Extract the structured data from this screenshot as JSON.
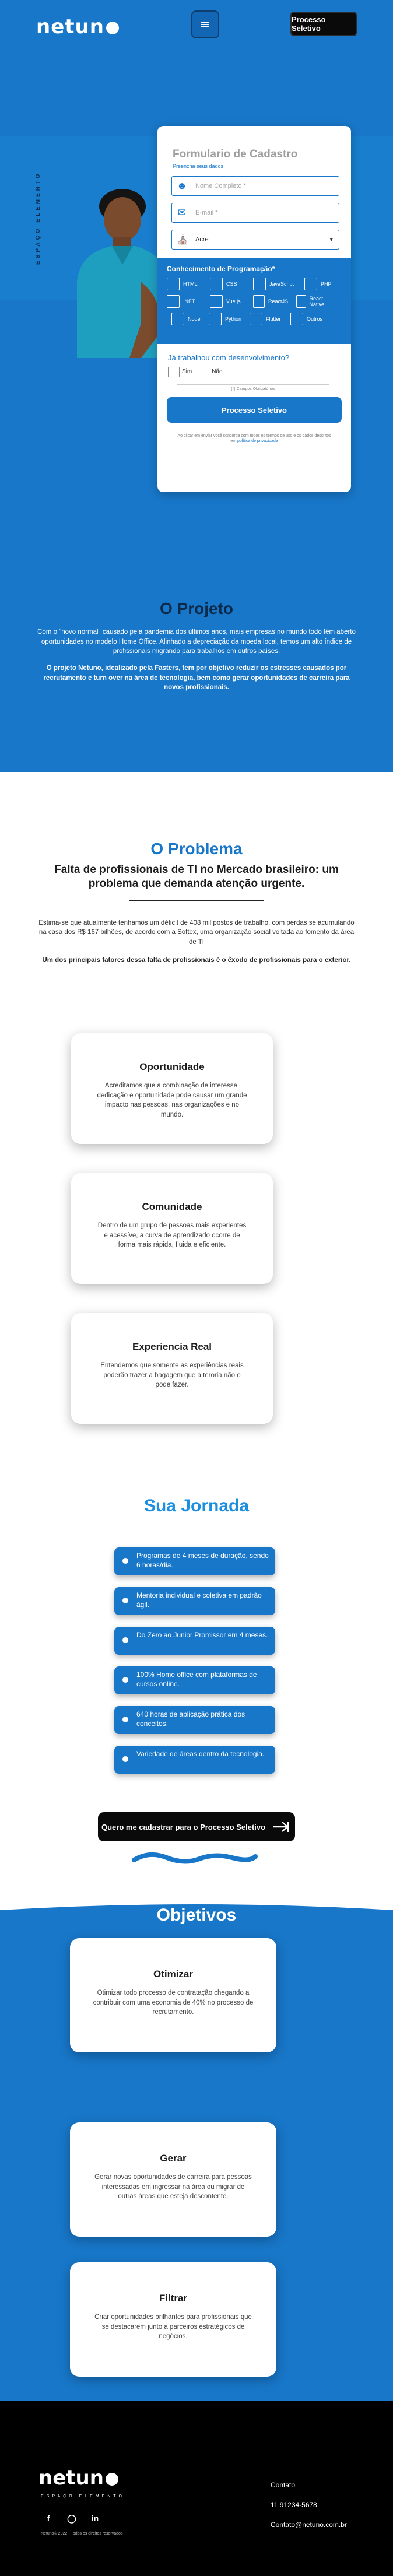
{
  "header": {
    "logo": "netun",
    "menu_label": "menu",
    "cta": "Processo Seletivo"
  },
  "hero": {
    "side_text": "ESPAÇO ELEMENTO",
    "form": {
      "title": "Formulario de Cadastro",
      "subtitle": "Preencha seus dados",
      "name_placeholder": "Nome Completo *",
      "email_placeholder": "E-mail *",
      "state_value": "Acre",
      "skills_title": "Conhecimento de Programação*",
      "skills_row1": [
        "HTML",
        "CSS",
        "JavaScript",
        "PHP"
      ],
      "skills_row2": [
        ".NET",
        "Vue.js",
        "ReactJS",
        "React Native"
      ],
      "skills_row3": [
        "Node",
        "Python",
        "Flutter",
        "Outros"
      ],
      "question": "Já trabalhou com desenvolvimento?",
      "yes": "Sim",
      "no": "Não",
      "required_note": "(*) Campos Obrigatórios",
      "submit": "Processo Seletivo",
      "fine_print": "Ao clicar em enviar você concorda com todos os termos de uso e os dados descritos em",
      "fine_link": "política de privacidade"
    }
  },
  "projeto": {
    "title": "O Projeto",
    "p1": "Com o \"novo normal\" causado pela pandemia dos últimos anos, mais empresas no mundo todo têm aberto oportunidades no modelo Home Office. Alinhado a depreciação da moeda local, temos um alto índice de profissionais migrando para trabalhos em outros países.",
    "p2": "O projeto Netuno, idealizado pela Fasters, tem por objetivo reduzir os estresses causados por recrutamento e turn over na área de tecnologia, bem como gerar oportunidades de carreira para novos profissionais."
  },
  "problema": {
    "title": "O Problema",
    "subtitle": "Falta de profissionais de TI no Mercado brasileiro: um problema que demanda atenção urgente.",
    "p1": "Estima-se que atualmente tenhamos um déficit de 408 mil postos de trabalho, com perdas se acumulando na casa dos R$ 167 bilhões, de acordo com a Softex, uma organização social voltada ao fomento da área de TI",
    "p2": "Um dos principais fatores dessa falta de profissionais é o êxodo de profissionais para o exterior.",
    "cards": [
      {
        "title": "Oportunidade",
        "text": "Acreditamos que a combinação de interesse, dedicação e oportunidade pode causar um grande impacto nas pessoas, nas organizações e no mundo."
      },
      {
        "title": "Comunidade",
        "text": "Dentro de um grupo de pessoas mais experientes e acessíve, a curva de aprendizado ocorre de forma mais rápida, fluida e eficiente."
      },
      {
        "title": "Experiencia Real",
        "text": "Entendemos que somente as experiências reais poderão trazer a bagagem que a teroria não o pode fazer."
      }
    ]
  },
  "jornada": {
    "title": "Sua Jornada",
    "items": [
      "Programas de 4 meses de duração, sendo 6 horas/dia.",
      "Mentoria individual e coletiva em padrão ágil.",
      "Do Zero ao Junior Promissor em 4 meses.",
      "100% Home office com plataformas de cursos online.",
      "640 horas de aplicação prática dos conceitos.",
      "Variedade de áreas dentro da tecnologia."
    ],
    "cta": "Quero me cadastrar para o Processo Seletivo"
  },
  "objetivos": {
    "title": "Objetivos",
    "cards": [
      {
        "title": "Otimizar",
        "text": "Otimizar todo processo de contratação chegando a contribuir com uma economia de 40% no processo de recrutamento."
      },
      {
        "title": "Gerar",
        "text": "Gerar novas oportunidades de carreira para pessoas interessadas em ingressar na área ou migrar de outras áreas que esteja descontente."
      },
      {
        "title": "Filtrar",
        "text": "Criar oportunidades brilhantes para profissionais que se destacarem junto a parceiros estratégicos de negócios."
      }
    ]
  },
  "footer": {
    "logo": "netun",
    "tagline": "ESPAÇO ELEMENTO",
    "copyright": "Netuno© 2022 - Todos os direitos reservados",
    "contact_label": "Contato",
    "phone": "11 91234-5678",
    "email": "Contato@netuno.com.br"
  },
  "colors": {
    "brand": "#1877c9",
    "dark": "#0a0a0a"
  }
}
